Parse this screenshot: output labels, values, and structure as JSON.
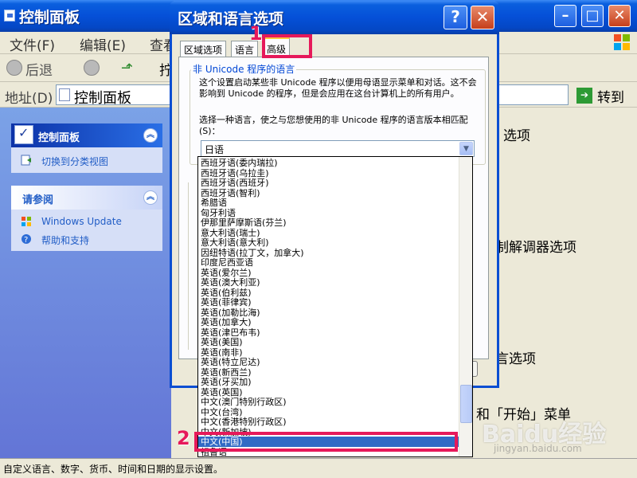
{
  "main_window": {
    "title": "控制面板",
    "menu": [
      "文件(F)",
      "编辑(E)",
      "查看"
    ],
    "toolbar": {
      "back_label": "后退",
      "truncated_label": "拧"
    },
    "address": {
      "label": "地址(D)",
      "value": "控制面板",
      "go_label": "转到"
    }
  },
  "task_pane": {
    "panel1": {
      "title": "控制面板",
      "link": "切换到分类视图"
    },
    "panel2": {
      "title": "请参阅",
      "links": [
        "Windows Update",
        "帮助和支持"
      ]
    }
  },
  "background_items": [
    "选项",
    "制解调器选项",
    "言选项",
    "和「开始」菜单"
  ],
  "status_bar": "自定义语言、数字、货币、时间和日期的显示设置。",
  "watermark": {
    "logo": "Baidu经验",
    "url": "jingyan.baidu.com"
  },
  "dialog": {
    "title": "区域和语言选项",
    "help_glyph": "?",
    "close_glyph": "✕",
    "tabs": [
      "区域选项",
      "语言",
      "高级"
    ],
    "active_tab": "高级",
    "group_label": "非 Unicode 程序的语言",
    "description": "这个设置启动某些非 Unicode 程序以便用母语显示菜单和对话。这不会影响到 Unicode 的程序，但是会应用在这台计算机上的所有用户。",
    "prompt": "选择一种语言，使之与您想使用的非 Unicode 程序的语言版本相匹配(S)：",
    "selected_value": "日语"
  },
  "dropdown": {
    "items": [
      "西班牙语(委内瑞拉)",
      "西班牙语(乌拉圭)",
      "西班牙语(西班牙)",
      "西班牙语(智利)",
      "希腊语",
      "匈牙利语",
      "伊那里萨摩斯语(芬兰)",
      "意大利语(瑞士)",
      "意大利语(意大利)",
      "因纽特语(拉丁文，加拿大)",
      "印度尼西亚语",
      "英语(爱尔兰)",
      "英语(澳大利亚)",
      "英语(伯利兹)",
      "英语(菲律宾)",
      "英语(加勒比海)",
      "英语(加拿大)",
      "英语(津巴布韦)",
      "英语(美国)",
      "英语(南非)",
      "英语(特立尼达)",
      "英语(新西兰)",
      "英语(牙买加)",
      "英语(英国)",
      "中文(澳门特别行政区)",
      "中文(台湾)",
      "中文(香港特别行政区)",
      "中文(新加坡)",
      "中文(中国)",
      "祖鲁语"
    ],
    "highlighted": "中文(中国)"
  },
  "annotations": [
    "1",
    "2"
  ],
  "colors": {
    "title_blue": "#0550d8",
    "highlight": "#316ac5",
    "annotation": "#e6195a"
  }
}
